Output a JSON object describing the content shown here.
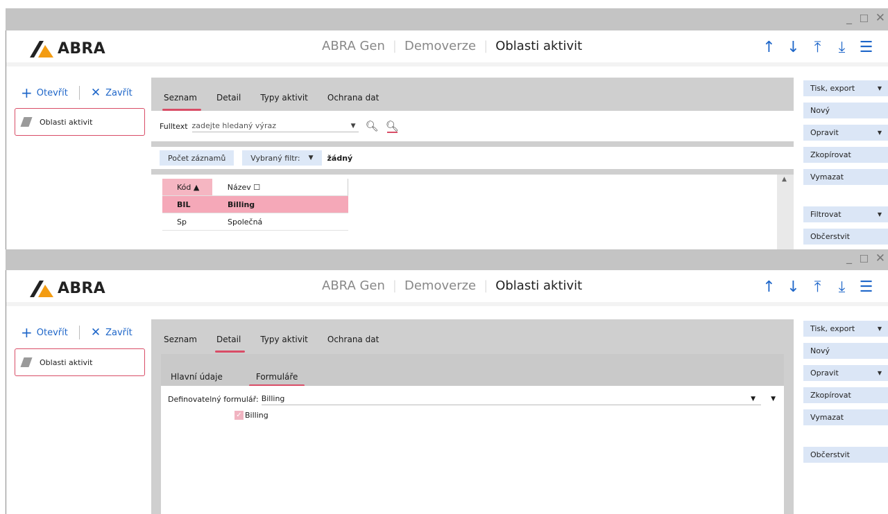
{
  "titlebar": {
    "minimize": "_",
    "maximize": "☐",
    "close": "✕"
  },
  "app": {
    "logo": "ABRA",
    "crumb1": "ABRA Gen",
    "crumb2": "Demoverze",
    "crumb3": "Oblasti aktivit"
  },
  "toolbar": {
    "open": "Otevřít",
    "close": "Zavřít"
  },
  "opened_tab": "Oblasti aktivit",
  "tabs": {
    "seznam": "Seznam",
    "detail": "Detail",
    "typy": "Typy aktivit",
    "ochrana": "Ochrana dat"
  },
  "fulltext": {
    "label": "Fulltext",
    "placeholder": "zadejte hledaný výraz"
  },
  "filter": {
    "count": "Počet záznamů",
    "selected": "Vybraný filtr:",
    "value": "žádný"
  },
  "grid": {
    "col1": "Kód ▲",
    "col2": "Název ☐",
    "rows": [
      {
        "kod": "BIL",
        "nazev": "Billing"
      },
      {
        "kod": "Sp",
        "nazev": "Společná"
      }
    ]
  },
  "subtabs": {
    "hlavni": "Hlavní údaje",
    "formulare": "Formuláře"
  },
  "detail": {
    "form_label": "Definovatelný formulář:",
    "form_value": "Billing",
    "checkbox_label": "Billing"
  },
  "actions": {
    "tisk": "Tisk, export",
    "novy": "Nový",
    "opravit": "Opravit",
    "zkopirovat": "Zkopírovat",
    "vymazat": "Vymazat",
    "filtrovat": "Filtrovat",
    "obcerstvit": "Občerstvit"
  },
  "colors": {
    "accent": "#d94c66",
    "blue": "#1e66c9",
    "brand_orange": "#f39c12",
    "brand_dark": "#222222"
  }
}
